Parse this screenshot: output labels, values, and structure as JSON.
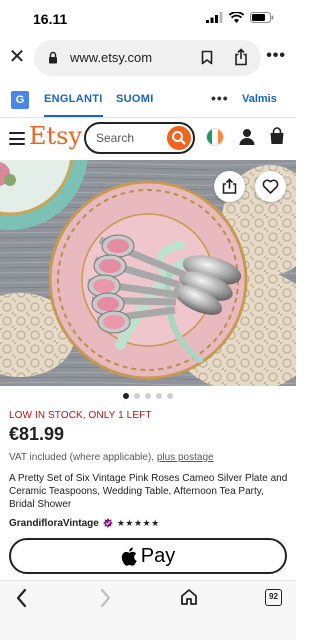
{
  "status_bar": {
    "time": "16.11"
  },
  "browser": {
    "url": "www.etsy.com",
    "icons": [
      "close-icon",
      "lock-icon",
      "bookmark-icon",
      "share-icon",
      "more-icon"
    ]
  },
  "translate": {
    "icon_letter": "G",
    "tabs": [
      {
        "label": "ENGLANTI",
        "active": true
      },
      {
        "label": "SUOMI",
        "active": false
      }
    ],
    "more": "•••",
    "done_label": "Valmis"
  },
  "header": {
    "logo": "Etsy",
    "search_placeholder": "Search",
    "brand_color": "#f1641e",
    "flag_colors": [
      "#169b62",
      "#ffffff",
      "#ff883e"
    ]
  },
  "gallery": {
    "dot_count": 5,
    "active_dot": 0
  },
  "product": {
    "stock": "LOW IN STOCK, ONLY 1 LEFT",
    "price": "€81.99",
    "vat": "VAT included (where applicable), ",
    "postage_link": "plus postage",
    "title": "A Pretty Set of Six Vintage Pink Roses Cameo Silver Plate and Ceramic Teaspoons, Wedding Table, Afternoon Tea Party, Bridal Shower",
    "shop_name": "GrandifloraVintage",
    "rating_stars": "★★★★★",
    "rating": 5
  },
  "apple_pay": {
    "label": "Pay"
  },
  "bottom_nav": {
    "tab_count": "92"
  }
}
